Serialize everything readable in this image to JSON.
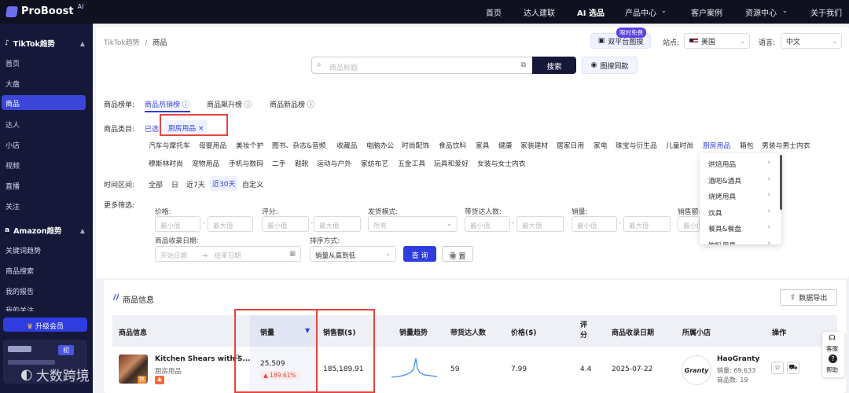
{
  "brand": {
    "name": "ProBoost",
    "sup": "AI"
  },
  "topnav": [
    {
      "label": "首页"
    },
    {
      "label": "达人建联"
    },
    {
      "label": "AI 选品"
    },
    {
      "label": "产品中心"
    },
    {
      "label": "客户案例"
    },
    {
      "label": "资源中心"
    },
    {
      "label": "关于我们"
    }
  ],
  "sidebar": {
    "tiktok_header": "TikTok趋势",
    "tiktok_items": [
      "首页",
      "大盘",
      "商品",
      "达人",
      "小店",
      "视频",
      "直播",
      "关注"
    ],
    "amazon_header": "Amazon趋势",
    "amazon_items": [
      "关键词趋势",
      "商品搜索",
      "我的报告",
      "我的关注"
    ],
    "vip_label": "升级会员",
    "user_tag": "初"
  },
  "breadcrumb": {
    "parent": "TikTok趋势",
    "sep": "/",
    "current": "商品"
  },
  "toolbar": {
    "dual_search_badge": "限时免费",
    "dual_search_label": "双平台图搜",
    "site_label": "站点:",
    "site_value": "美国",
    "lang_label": "语言:",
    "lang_value": "中文"
  },
  "search": {
    "placeholder": "商品标题",
    "button": "搜索",
    "image_search": "图搜同款"
  },
  "rank": {
    "label": "商品榜单:",
    "tabs": [
      "商品热销榜",
      "商品飙升榜",
      "商品新品榜"
    ]
  },
  "category": {
    "label": "商品类目:",
    "selected_prefix": "已选",
    "selected_tag": "厨房用品",
    "row1": [
      "汽车与摩托车",
      "母婴用品",
      "美妆个护",
      "图书、杂志&音频",
      "收藏品",
      "电脑办公",
      "时尚配饰",
      "食品饮料",
      "家具",
      "健康",
      "家装建材",
      "居家日用",
      "家电",
      "珠宝与衍生品",
      "儿童时尚",
      "厨房用品",
      "箱包",
      "男装与男士内衣"
    ],
    "row2": [
      "穆斯林时尚",
      "宠物用品",
      "手机与数码",
      "二手",
      "鞋靴",
      "运动与户外",
      "家纺布艺",
      "五金工具",
      "玩具和爱好",
      "女装与女士内衣"
    ]
  },
  "dropdown": [
    "烘焙用品",
    "酒吧&酒具",
    "烧烤用具",
    "炊具",
    "餐具&餐盘",
    "饮料用具"
  ],
  "time": {
    "label": "时间区间:",
    "options": [
      "全部",
      "日",
      "近7天",
      "近30天",
      "自定义"
    ]
  },
  "filters": {
    "label": "更多筛选:",
    "price": "价格:",
    "rating": "评分:",
    "ship": "发货模式:",
    "creators": "带货达人数:",
    "sales": "销量:",
    "revenue": "销售额:",
    "min": "最小值",
    "max": "最大值",
    "all": "所有",
    "date_label": "商品收录日期:",
    "start": "开始日期",
    "end": "结束日期",
    "sort_label": "排序方式:",
    "sort_value": "销量从高到低",
    "query": "查 询",
    "reset": "重 置"
  },
  "info": {
    "title": "商品信息",
    "export": "数据导出"
  },
  "table": {
    "headers": [
      "商品信息",
      "销量",
      "销售额($)",
      "销量趋势",
      "带货达人数",
      "价格($)",
      "评分",
      "商品收录日期",
      "所属小店",
      "操作"
    ],
    "rows": [
      {
        "name": "Kitchen Shears with S...",
        "category": "厨房用品",
        "sales": "25,509",
        "sales_change": "189.61%",
        "revenue": "185,189.91",
        "creators": "59",
        "price": "7.99",
        "rating": "4.4",
        "date": "2025-07-22",
        "shop_name": "HaoGranty",
        "shop_logo": "Granty",
        "shop_sales_label": "销量:",
        "shop_sales": "69,633",
        "shop_items_label": "商品数:",
        "shop_items": "19"
      }
    ]
  },
  "float": {
    "service": "客服",
    "help": "帮助"
  },
  "watermark": "大数跨境",
  "colors": {
    "accent": "#2f3de0",
    "nav_bg": "#0f1020",
    "sidebar_bg": "#16183a",
    "highlight": "#e4453f"
  }
}
